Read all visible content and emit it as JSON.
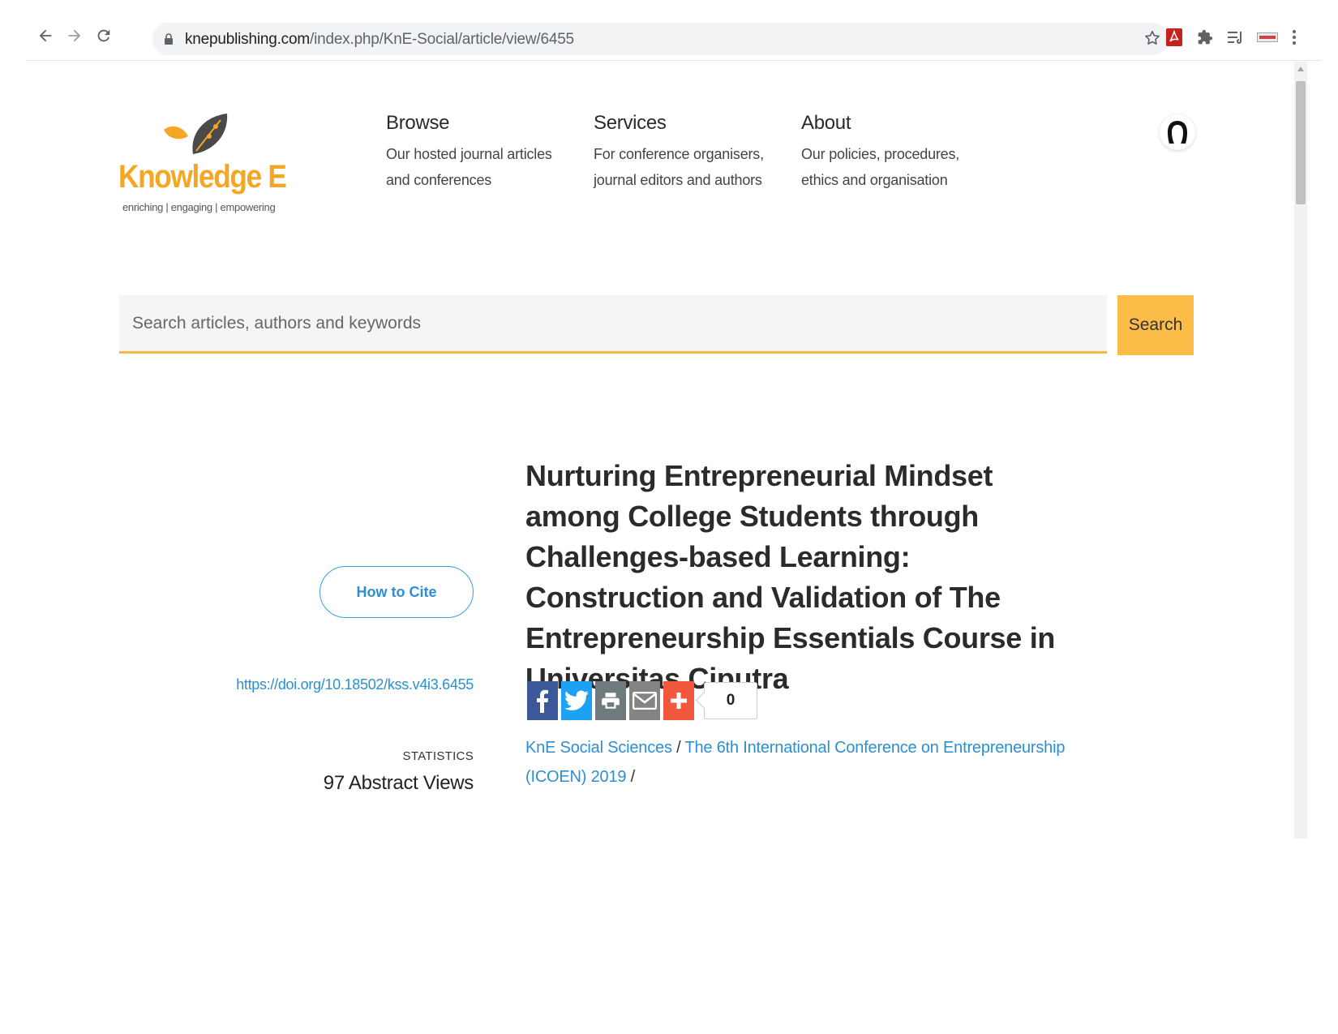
{
  "browser": {
    "url_domain": "knepublishing.com",
    "url_path": "/index.php/KnE-Social/article/view/6455"
  },
  "logo": {
    "wordmark": "Knowledge E",
    "tagline": "enriching | engaging | empowering"
  },
  "nav": [
    {
      "title": "Browse",
      "desc": "Our hosted journal articles and conferences"
    },
    {
      "title": "Services",
      "desc": "For conference organisers, journal editors and authors"
    },
    {
      "title": "About",
      "desc": "Our policies, procedures, ethics and organisation"
    }
  ],
  "search": {
    "placeholder": "Search articles, authors and keywords",
    "button_label": "Search"
  },
  "article": {
    "title": "Nurturing Entrepreneurial Mindset among College Students through Challenges-based Learning: Construction and Validation of The Entrepreneurship Essentials Course in Universitas Ciputra",
    "cite_label": "How to Cite",
    "doi": "https://doi.org/10.18502/kss.v4i3.6455",
    "stats_label": "STATISTICS",
    "stats_value": "97 Abstract Views",
    "share_count": "0",
    "breadcrumb": {
      "journal": "KnE Social Sciences",
      "separator1": " / ",
      "conference": "The 6th International Conference on Entrepreneurship (ICOEN) 2019",
      "separator2": " /"
    }
  },
  "colors": {
    "accent": "#fbbc48",
    "link": "#2d8fd0",
    "facebook": "#3b5998",
    "twitter": "#1da1f2",
    "print": "#6f7a7e",
    "email": "#848484",
    "more": "#f2583e"
  },
  "icons": {
    "share": [
      "facebook-icon",
      "twitter-icon",
      "print-icon",
      "email-icon",
      "plus-icon"
    ]
  }
}
